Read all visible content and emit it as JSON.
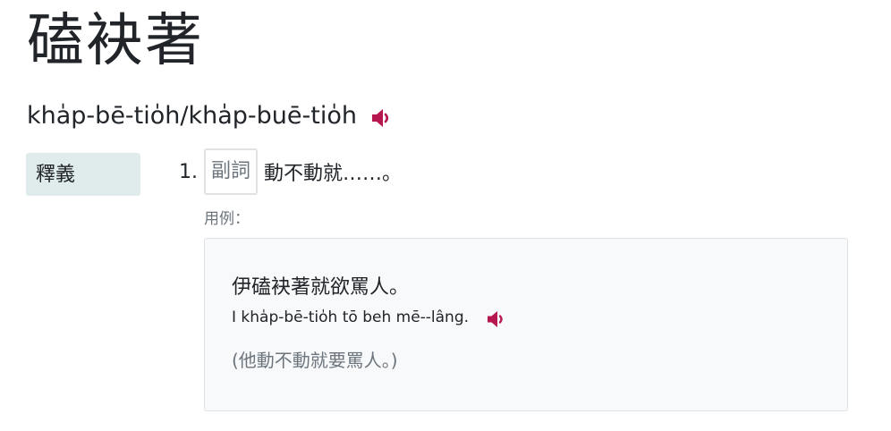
{
  "entry": {
    "headword": "磕袂著",
    "romanization": "kha̍p-bē-tio̍h/kha̍p-buē-tio̍h",
    "audio_icon": "volume-up-icon"
  },
  "sections": {
    "definition_label": "釋義"
  },
  "sense": {
    "number": "1.",
    "part_of_speech": "副詞",
    "definition": "動不動就……。",
    "example_label": "用例：",
    "example": {
      "sentence": "伊磕袂著就欲罵人。",
      "romanization": "I kha̍p-bē-tio̍h tō beh mē--lâng.",
      "translation": "(他動不動就要罵人。)"
    }
  },
  "colors": {
    "audio_icon": "#b5174e",
    "label_bg": "#e0ecec",
    "example_bg": "#f8f9fa",
    "muted_text": "#6c757d"
  }
}
